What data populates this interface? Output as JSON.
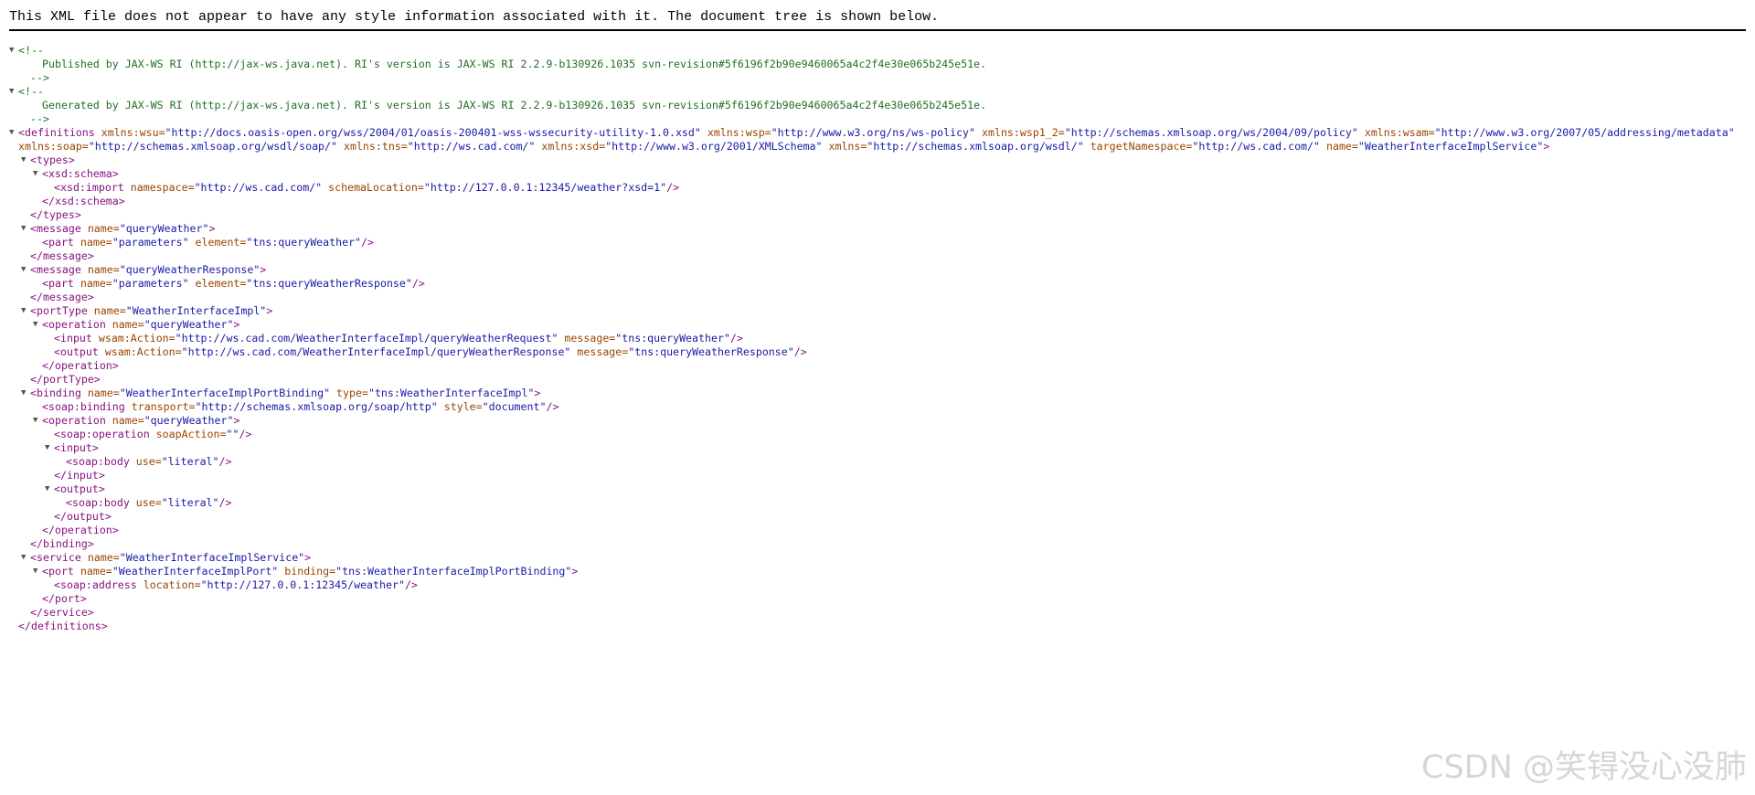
{
  "header": {
    "message": "This XML file does not appear to have any style information associated with it. The document tree is shown below."
  },
  "icons": {
    "expanded": "▼"
  },
  "colors": {
    "tag": "#881280",
    "attribute_name": "#994500",
    "attribute_value": "#1a1aa6",
    "comment": "#236e25"
  },
  "tree": {
    "lines": [
      {
        "indent": 0,
        "toggle": true,
        "parts": [
          {
            "t": "comment",
            "v": "<!--"
          }
        ]
      },
      {
        "indent": 2,
        "toggle": false,
        "parts": [
          {
            "t": "comment",
            "v": "Published by JAX-WS RI (http://jax-ws.java.net). RI's version is JAX-WS RI 2.2.9-b130926.1035 svn-revision#5f6196f2b90e9460065a4c2f4e30e065b245e51e."
          }
        ]
      },
      {
        "indent": 1,
        "toggle": false,
        "parts": [
          {
            "t": "comment",
            "v": "-->"
          }
        ]
      },
      {
        "indent": 0,
        "toggle": true,
        "parts": [
          {
            "t": "comment",
            "v": "<!--"
          }
        ]
      },
      {
        "indent": 2,
        "toggle": false,
        "parts": [
          {
            "t": "comment",
            "v": "Generated by JAX-WS RI (http://jax-ws.java.net). RI's version is JAX-WS RI 2.2.9-b130926.1035 svn-revision#5f6196f2b90e9460065a4c2f4e30e065b245e51e."
          }
        ]
      },
      {
        "indent": 1,
        "toggle": false,
        "parts": [
          {
            "t": "comment",
            "v": "-->"
          }
        ]
      },
      {
        "indent": 0,
        "toggle": true,
        "parts": [
          {
            "t": "tag",
            "v": "<definitions"
          },
          {
            "t": "attr",
            "v": " xmlns:wsu="
          },
          {
            "t": "val",
            "v": "\"http://docs.oasis-open.org/wss/2004/01/oasis-200401-wss-wssecurity-utility-1.0.xsd\""
          },
          {
            "t": "attr",
            "v": " xmlns:wsp="
          },
          {
            "t": "val",
            "v": "\"http://www.w3.org/ns/ws-policy\""
          },
          {
            "t": "attr",
            "v": " xmlns:wsp1_2="
          },
          {
            "t": "val",
            "v": "\"http://schemas.xmlsoap.org/ws/2004/09/policy\""
          },
          {
            "t": "attr",
            "v": " xmlns:wsam="
          },
          {
            "t": "val",
            "v": "\"http://www.w3.org/2007/05/addressing/metadata\""
          }
        ]
      },
      {
        "indent": 0,
        "toggle": false,
        "parts": [
          {
            "t": "attr",
            "v": "xmlns:soap="
          },
          {
            "t": "val",
            "v": "\"http://schemas.xmlsoap.org/wsdl/soap/\""
          },
          {
            "t": "attr",
            "v": " xmlns:tns="
          },
          {
            "t": "val",
            "v": "\"http://ws.cad.com/\""
          },
          {
            "t": "attr",
            "v": " xmlns:xsd="
          },
          {
            "t": "val",
            "v": "\"http://www.w3.org/2001/XMLSchema\""
          },
          {
            "t": "attr",
            "v": " xmlns="
          },
          {
            "t": "val",
            "v": "\"http://schemas.xmlsoap.org/wsdl/\""
          },
          {
            "t": "attr",
            "v": " targetNamespace="
          },
          {
            "t": "val",
            "v": "\"http://ws.cad.com/\""
          },
          {
            "t": "attr",
            "v": " name="
          },
          {
            "t": "val",
            "v": "\"WeatherInterfaceImplService\""
          },
          {
            "t": "tag",
            "v": ">"
          }
        ]
      },
      {
        "indent": 1,
        "toggle": true,
        "parts": [
          {
            "t": "tag",
            "v": "<types>"
          }
        ]
      },
      {
        "indent": 2,
        "toggle": true,
        "parts": [
          {
            "t": "tag",
            "v": "<xsd:schema>"
          }
        ]
      },
      {
        "indent": 3,
        "toggle": false,
        "parts": [
          {
            "t": "tag",
            "v": "<xsd:import"
          },
          {
            "t": "attr",
            "v": " namespace="
          },
          {
            "t": "val",
            "v": "\"http://ws.cad.com/\""
          },
          {
            "t": "attr",
            "v": " schemaLocation="
          },
          {
            "t": "val",
            "v": "\"http://127.0.0.1:12345/weather?xsd=1\""
          },
          {
            "t": "tag",
            "v": "/>"
          }
        ]
      },
      {
        "indent": 2,
        "toggle": false,
        "parts": [
          {
            "t": "tag",
            "v": "</xsd:schema>"
          }
        ]
      },
      {
        "indent": 1,
        "toggle": false,
        "parts": [
          {
            "t": "tag",
            "v": "</types>"
          }
        ]
      },
      {
        "indent": 1,
        "toggle": true,
        "parts": [
          {
            "t": "tag",
            "v": "<message"
          },
          {
            "t": "attr",
            "v": " name="
          },
          {
            "t": "val",
            "v": "\"queryWeather\""
          },
          {
            "t": "tag",
            "v": ">"
          }
        ]
      },
      {
        "indent": 2,
        "toggle": false,
        "parts": [
          {
            "t": "tag",
            "v": "<part"
          },
          {
            "t": "attr",
            "v": " name="
          },
          {
            "t": "val",
            "v": "\"parameters\""
          },
          {
            "t": "attr",
            "v": " element="
          },
          {
            "t": "val",
            "v": "\"tns:queryWeather\""
          },
          {
            "t": "tag",
            "v": "/>"
          }
        ]
      },
      {
        "indent": 1,
        "toggle": false,
        "parts": [
          {
            "t": "tag",
            "v": "</message>"
          }
        ]
      },
      {
        "indent": 1,
        "toggle": true,
        "parts": [
          {
            "t": "tag",
            "v": "<message"
          },
          {
            "t": "attr",
            "v": " name="
          },
          {
            "t": "val",
            "v": "\"queryWeatherResponse\""
          },
          {
            "t": "tag",
            "v": ">"
          }
        ]
      },
      {
        "indent": 2,
        "toggle": false,
        "parts": [
          {
            "t": "tag",
            "v": "<part"
          },
          {
            "t": "attr",
            "v": " name="
          },
          {
            "t": "val",
            "v": "\"parameters\""
          },
          {
            "t": "attr",
            "v": " element="
          },
          {
            "t": "val",
            "v": "\"tns:queryWeatherResponse\""
          },
          {
            "t": "tag",
            "v": "/>"
          }
        ]
      },
      {
        "indent": 1,
        "toggle": false,
        "parts": [
          {
            "t": "tag",
            "v": "</message>"
          }
        ]
      },
      {
        "indent": 1,
        "toggle": true,
        "parts": [
          {
            "t": "tag",
            "v": "<portType"
          },
          {
            "t": "attr",
            "v": " name="
          },
          {
            "t": "val",
            "v": "\"WeatherInterfaceImpl\""
          },
          {
            "t": "tag",
            "v": ">"
          }
        ]
      },
      {
        "indent": 2,
        "toggle": true,
        "parts": [
          {
            "t": "tag",
            "v": "<operation"
          },
          {
            "t": "attr",
            "v": " name="
          },
          {
            "t": "val",
            "v": "\"queryWeather\""
          },
          {
            "t": "tag",
            "v": ">"
          }
        ]
      },
      {
        "indent": 3,
        "toggle": false,
        "parts": [
          {
            "t": "tag",
            "v": "<input"
          },
          {
            "t": "attr",
            "v": " wsam:Action="
          },
          {
            "t": "val",
            "v": "\"http://ws.cad.com/WeatherInterfaceImpl/queryWeatherRequest\""
          },
          {
            "t": "attr",
            "v": " message="
          },
          {
            "t": "val",
            "v": "\"tns:queryWeather\""
          },
          {
            "t": "tag",
            "v": "/>"
          }
        ]
      },
      {
        "indent": 3,
        "toggle": false,
        "parts": [
          {
            "t": "tag",
            "v": "<output"
          },
          {
            "t": "attr",
            "v": " wsam:Action="
          },
          {
            "t": "val",
            "v": "\"http://ws.cad.com/WeatherInterfaceImpl/queryWeatherResponse\""
          },
          {
            "t": "attr",
            "v": " message="
          },
          {
            "t": "val",
            "v": "\"tns:queryWeatherResponse\""
          },
          {
            "t": "tag",
            "v": "/>"
          }
        ]
      },
      {
        "indent": 2,
        "toggle": false,
        "parts": [
          {
            "t": "tag",
            "v": "</operation>"
          }
        ]
      },
      {
        "indent": 1,
        "toggle": false,
        "parts": [
          {
            "t": "tag",
            "v": "</portType>"
          }
        ]
      },
      {
        "indent": 1,
        "toggle": true,
        "parts": [
          {
            "t": "tag",
            "v": "<binding"
          },
          {
            "t": "attr",
            "v": " name="
          },
          {
            "t": "val",
            "v": "\"WeatherInterfaceImplPortBinding\""
          },
          {
            "t": "attr",
            "v": " type="
          },
          {
            "t": "val",
            "v": "\"tns:WeatherInterfaceImpl\""
          },
          {
            "t": "tag",
            "v": ">"
          }
        ]
      },
      {
        "indent": 2,
        "toggle": false,
        "parts": [
          {
            "t": "tag",
            "v": "<soap:binding"
          },
          {
            "t": "attr",
            "v": " transport="
          },
          {
            "t": "val",
            "v": "\"http://schemas.xmlsoap.org/soap/http\""
          },
          {
            "t": "attr",
            "v": " style="
          },
          {
            "t": "val",
            "v": "\"document\""
          },
          {
            "t": "tag",
            "v": "/>"
          }
        ]
      },
      {
        "indent": 2,
        "toggle": true,
        "parts": [
          {
            "t": "tag",
            "v": "<operation"
          },
          {
            "t": "attr",
            "v": " name="
          },
          {
            "t": "val",
            "v": "\"queryWeather\""
          },
          {
            "t": "tag",
            "v": ">"
          }
        ]
      },
      {
        "indent": 3,
        "toggle": false,
        "parts": [
          {
            "t": "tag",
            "v": "<soap:operation"
          },
          {
            "t": "attr",
            "v": " soapAction="
          },
          {
            "t": "val",
            "v": "\"\""
          },
          {
            "t": "tag",
            "v": "/>"
          }
        ]
      },
      {
        "indent": 3,
        "toggle": true,
        "parts": [
          {
            "t": "tag",
            "v": "<input>"
          }
        ]
      },
      {
        "indent": 4,
        "toggle": false,
        "parts": [
          {
            "t": "tag",
            "v": "<soap:body"
          },
          {
            "t": "attr",
            "v": " use="
          },
          {
            "t": "val",
            "v": "\"literal\""
          },
          {
            "t": "tag",
            "v": "/>"
          }
        ]
      },
      {
        "indent": 3,
        "toggle": false,
        "parts": [
          {
            "t": "tag",
            "v": "</input>"
          }
        ]
      },
      {
        "indent": 3,
        "toggle": true,
        "parts": [
          {
            "t": "tag",
            "v": "<output>"
          }
        ]
      },
      {
        "indent": 4,
        "toggle": false,
        "parts": [
          {
            "t": "tag",
            "v": "<soap:body"
          },
          {
            "t": "attr",
            "v": " use="
          },
          {
            "t": "val",
            "v": "\"literal\""
          },
          {
            "t": "tag",
            "v": "/>"
          }
        ]
      },
      {
        "indent": 3,
        "toggle": false,
        "parts": [
          {
            "t": "tag",
            "v": "</output>"
          }
        ]
      },
      {
        "indent": 2,
        "toggle": false,
        "parts": [
          {
            "t": "tag",
            "v": "</operation>"
          }
        ]
      },
      {
        "indent": 1,
        "toggle": false,
        "parts": [
          {
            "t": "tag",
            "v": "</binding>"
          }
        ]
      },
      {
        "indent": 1,
        "toggle": true,
        "parts": [
          {
            "t": "tag",
            "v": "<service"
          },
          {
            "t": "attr",
            "v": " name="
          },
          {
            "t": "val",
            "v": "\"WeatherInterfaceImplService\""
          },
          {
            "t": "tag",
            "v": ">"
          }
        ]
      },
      {
        "indent": 2,
        "toggle": true,
        "parts": [
          {
            "t": "tag",
            "v": "<port"
          },
          {
            "t": "attr",
            "v": " name="
          },
          {
            "t": "val",
            "v": "\"WeatherInterfaceImplPort\""
          },
          {
            "t": "attr",
            "v": " binding="
          },
          {
            "t": "val",
            "v": "\"tns:WeatherInterfaceImplPortBinding\""
          },
          {
            "t": "tag",
            "v": ">"
          }
        ]
      },
      {
        "indent": 3,
        "toggle": false,
        "parts": [
          {
            "t": "tag",
            "v": "<soap:address"
          },
          {
            "t": "attr",
            "v": " location="
          },
          {
            "t": "val",
            "v": "\"http://127.0.0.1:12345/weather\""
          },
          {
            "t": "tag",
            "v": "/>"
          }
        ]
      },
      {
        "indent": 2,
        "toggle": false,
        "parts": [
          {
            "t": "tag",
            "v": "</port>"
          }
        ]
      },
      {
        "indent": 1,
        "toggle": false,
        "parts": [
          {
            "t": "tag",
            "v": "</service>"
          }
        ]
      },
      {
        "indent": 0,
        "toggle": false,
        "parts": [
          {
            "t": "tag",
            "v": "</definitions>"
          }
        ]
      }
    ]
  },
  "watermark": {
    "text": "CSDN @笑锝没心没肺"
  }
}
